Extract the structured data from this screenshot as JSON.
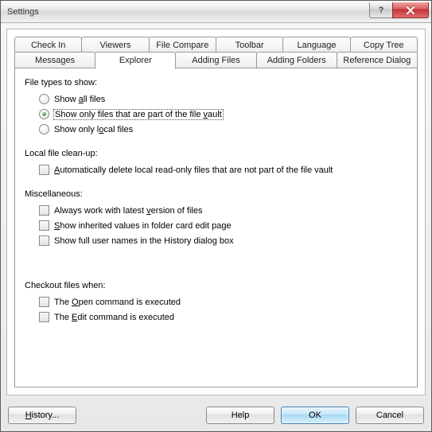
{
  "window": {
    "title": "Settings"
  },
  "tabs": {
    "row1": [
      "Check In",
      "Viewers",
      "File Compare",
      "Toolbar",
      "Language",
      "Copy Tree"
    ],
    "row2": [
      "Messages",
      "Explorer",
      "Adding Files",
      "Adding Folders",
      "Reference Dialog"
    ],
    "active": "Explorer"
  },
  "groups": {
    "file_types": {
      "label": "File types to show:",
      "opts": {
        "all": "Show all files",
        "vault": "Show only files that are part of the file vault",
        "local": "Show only local files"
      },
      "selected": "vault"
    },
    "cleanup": {
      "label": "Local file clean-up:",
      "opt": "Automatically delete local read-only files that are not part of the file vault"
    },
    "misc": {
      "label": "Miscellaneous:",
      "opts": {
        "latest": "Always work with latest version of files",
        "inherited": "Show inherited values in folder card edit page",
        "fullnames": "Show full user names in the History dialog box"
      }
    },
    "checkout": {
      "label": "Checkout files when:",
      "opts": {
        "open": "The Open command is executed",
        "edit": "The Edit command is executed"
      }
    }
  },
  "buttons": {
    "history": "History...",
    "help": "Help",
    "ok": "OK",
    "cancel": "Cancel"
  }
}
